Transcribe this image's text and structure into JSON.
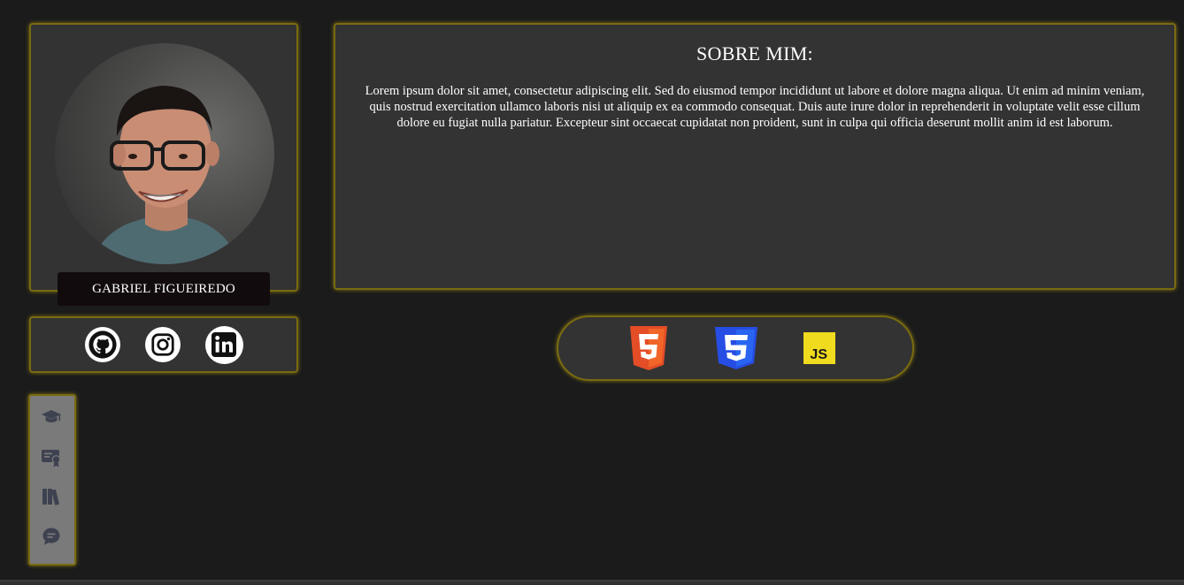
{
  "profile": {
    "name": "GABRIEL FIGUEIREDO",
    "photo_alt": "Foto de perfil"
  },
  "social": {
    "links": [
      {
        "icon": "github-icon"
      },
      {
        "icon": "instagram-icon"
      },
      {
        "icon": "linkedin-icon"
      }
    ]
  },
  "about": {
    "title": "SOBRE MIM:",
    "text": "Lorem ipsum dolor sit amet, consectetur adipiscing elit. Sed do eiusmod tempor incididunt ut labore et dolore magna aliqua. Ut enim ad minim veniam, quis nostrud exercitation ullamco laboris nisi ut aliquip ex ea commodo consequat. Duis aute irure dolor in reprehenderit in voluptate velit esse cillum dolore eu fugiat nulla pariatur. Excepteur sint occaecat cupidatat non proident, sunt in culpa qui officia deserunt mollit anim id est laborum."
  },
  "technologies": [
    {
      "icon": "html5-icon",
      "label": "5",
      "color": "#e44d26"
    },
    {
      "icon": "css3-icon",
      "label": "3",
      "color": "#264de4"
    },
    {
      "icon": "javascript-icon",
      "label": "JS",
      "color": "#f0db1e"
    }
  ],
  "nav": {
    "items": [
      {
        "icon": "graduation-cap-icon"
      },
      {
        "icon": "certificate-icon"
      },
      {
        "icon": "books-icon"
      },
      {
        "icon": "chat-icon"
      }
    ]
  },
  "colors": {
    "background": "#1b1b1b",
    "panel": "#333333",
    "border_glow": "#b8a010",
    "nav_background": "#7a7a7a",
    "nav_icon": "#3e4250"
  }
}
